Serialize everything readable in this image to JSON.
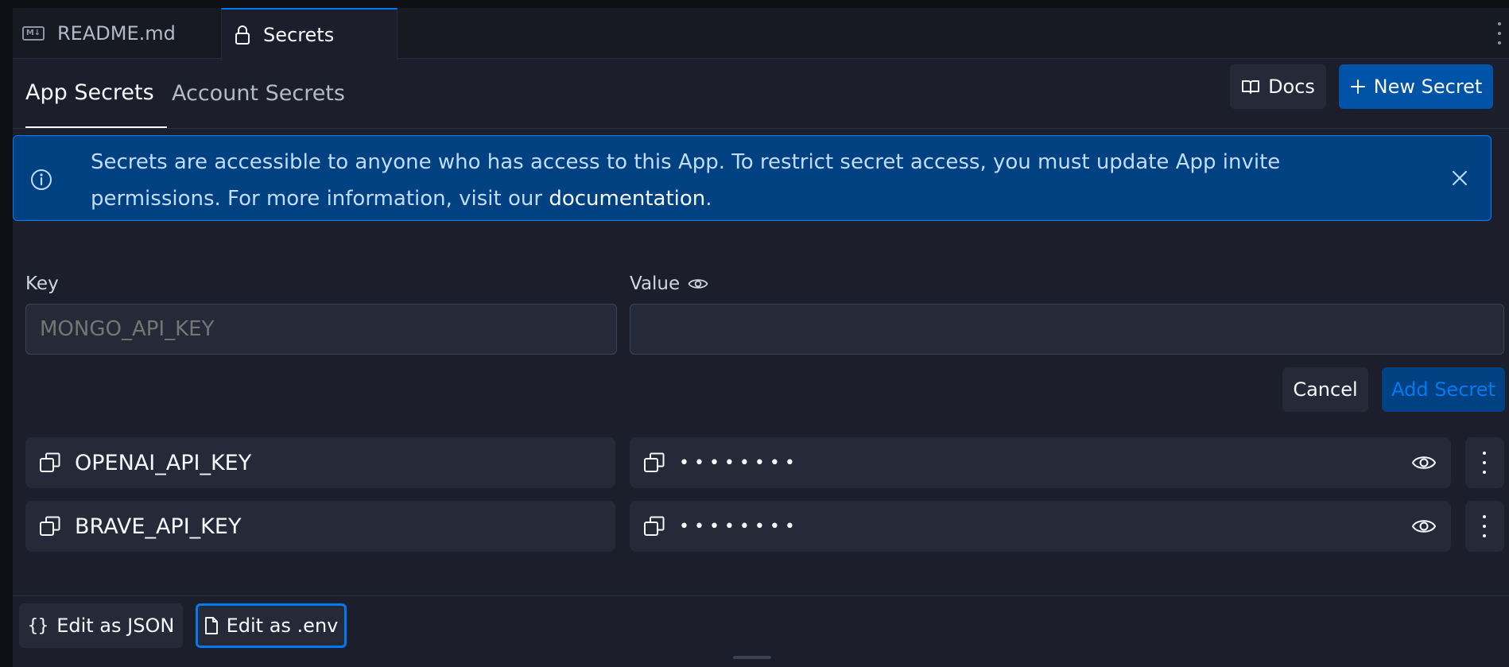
{
  "file_tabs": [
    {
      "label": "README.md",
      "icon": "markdown-icon",
      "icon_text": "M↓"
    },
    {
      "label": "Secrets",
      "icon": "lock-icon"
    }
  ],
  "sub_tabs": {
    "app": "App Secrets",
    "account": "Account Secrets"
  },
  "toolbar": {
    "docs_label": "Docs",
    "new_secret_label": "New Secret"
  },
  "banner": {
    "text": "Secrets are accessible to anyone who has access to this App. To restrict secret access, you must update App invite permissions. For more information, visit our ",
    "link": "documentation",
    "suffix": "."
  },
  "form": {
    "key_label": "Key",
    "value_label": "Value",
    "key_placeholder": "MONGO_API_KEY",
    "value_placeholder": "",
    "cancel_label": "Cancel",
    "add_label": "Add Secret"
  },
  "secrets": [
    {
      "key": "OPENAI_API_KEY",
      "masked": "••••••••"
    },
    {
      "key": "BRAVE_API_KEY",
      "masked": "••••••••"
    }
  ],
  "bottom": {
    "json_label": "Edit as JSON",
    "env_label": "Edit as .env"
  },
  "colors": {
    "accent": "#0079f2",
    "primary_button": "#0053a6",
    "banner_bg": "#004182",
    "surface": "#1c1f2b"
  }
}
